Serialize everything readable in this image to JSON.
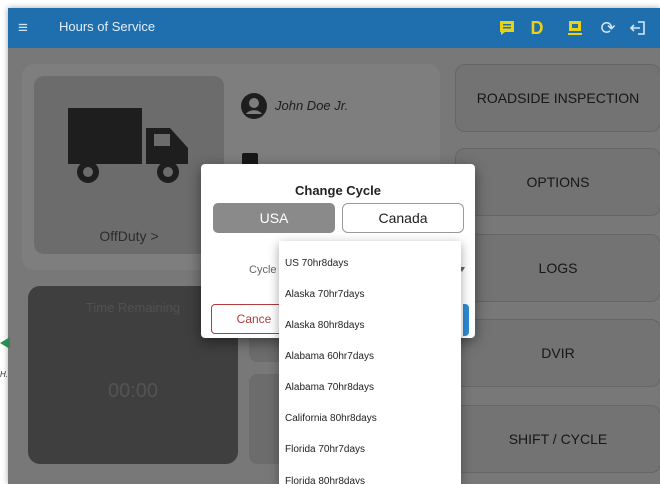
{
  "topbar": {
    "title": "Hours of Service",
    "status_letter": "D",
    "icons": [
      "menu-icon",
      "message-icon",
      "device-sync-icon",
      "refresh-icon",
      "logout-icon"
    ],
    "color": "#1f6fae"
  },
  "status": {
    "driver_name": "John Doe Jr.",
    "duty_status": "OffDuty >",
    "time_remaining_label": "Time Remaining",
    "time_remaining_value": "00:00"
  },
  "tiles": {
    "roadside": "ROADSIDE INSPECTION",
    "options": "OPTIONS",
    "logs": "LOGS",
    "dvir": "DVIR",
    "shift_cycle": "SHIFT / CYCLE"
  },
  "dialog": {
    "title": "Change Cycle",
    "tab_usa": "USA",
    "tab_canada": "Canada",
    "selected_tab": "USA",
    "cycle_label": "Cycle",
    "cancel_label": "Cance"
  },
  "dropdown": {
    "options": [
      "US 70hr8days",
      "Alaska 70hr7days",
      "Alaska 80hr8days",
      "Alabama 60hr7days",
      "Alabama 70hr8days",
      "California 80hr8days",
      "Florida 70hr7days",
      "Florida 80hr8days"
    ]
  },
  "edge": {
    "text": "H."
  }
}
